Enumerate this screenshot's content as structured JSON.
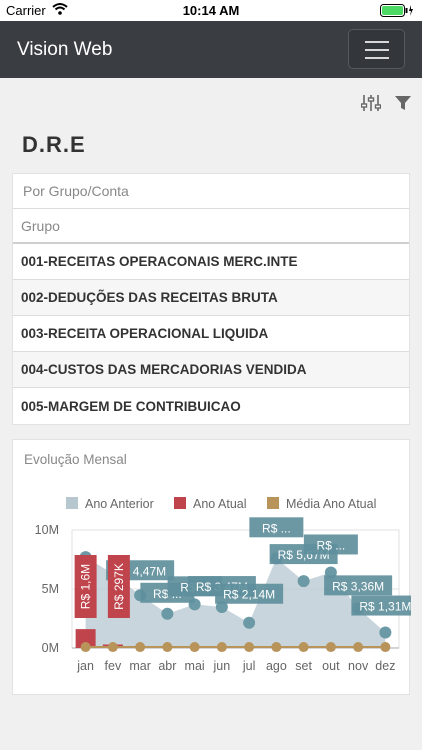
{
  "status": {
    "carrier": "Carrier",
    "time": "10:14 AM"
  },
  "navbar": {
    "brand": "Vision Web"
  },
  "page": {
    "title": "D.R.E"
  },
  "table": {
    "view": "Por Grupo/Conta",
    "header": "Grupo",
    "rows": [
      "001-RECEITAS OPERACONAIS MERC.INTE",
      "002-DEDUÇÕES DAS RECEITAS BRUTA",
      "003-RECEITA OPERACIONAL LIQUIDA",
      "004-CUSTOS DAS MERCADORIAS VENDIDA",
      "005-MARGEM DE CONTRIBUICAO"
    ]
  },
  "chart": {
    "title": "Evolução Mensal",
    "colors": {
      "anterior": "#b6c7d0",
      "atual": "#c0444c",
      "media": "#b8935a",
      "line": "#6b9aa6",
      "label_bg": "#5f8f9c"
    }
  },
  "chart_data": {
    "type": "area",
    "categories": [
      "jan",
      "fev",
      "mar",
      "abr",
      "mai",
      "jun",
      "jul",
      "ago",
      "set",
      "out",
      "nov",
      "dez"
    ],
    "ylim": [
      0,
      10000000
    ],
    "yticks": [
      [
        "0M",
        0
      ],
      [
        "5M",
        5000000
      ],
      [
        "10M",
        10000000
      ]
    ],
    "legend": {
      "position": "top",
      "entries": [
        "Ano Anterior",
        "Ano Atual",
        "Média Ano Atual"
      ]
    },
    "series": [
      {
        "name": "Ano Anterior",
        "kind": "area",
        "values": [
          7700000,
          6300000,
          4470000,
          2900000,
          3700000,
          3470000,
          2140000,
          7600000,
          5670000,
          6400000,
          3360000,
          1310000
        ],
        "labels": [
          "",
          "",
          "R$ 4,47M",
          "R$ ...",
          "R$ ...",
          "R$ 3,47M",
          "R$ 2,14M",
          "R$ ...",
          "R$ 5,67M",
          "R$ ...",
          "R$ 3,36M",
          "R$ 1,31M"
        ]
      },
      {
        "name": "Ano Atual",
        "kind": "bar",
        "values": [
          1600000,
          297000,
          0,
          0,
          0,
          0,
          0,
          0,
          0,
          0,
          0,
          0
        ],
        "labels": [
          "R$ 1,6M",
          "R$ 297K",
          "",
          "",
          "",
          "",
          "",
          "",
          "",
          "",
          "",
          ""
        ]
      },
      {
        "name": "Média Ano Atual",
        "kind": "line",
        "values": [
          80000,
          80000,
          80000,
          80000,
          80000,
          80000,
          80000,
          80000,
          80000,
          80000,
          80000,
          80000
        ]
      }
    ]
  }
}
